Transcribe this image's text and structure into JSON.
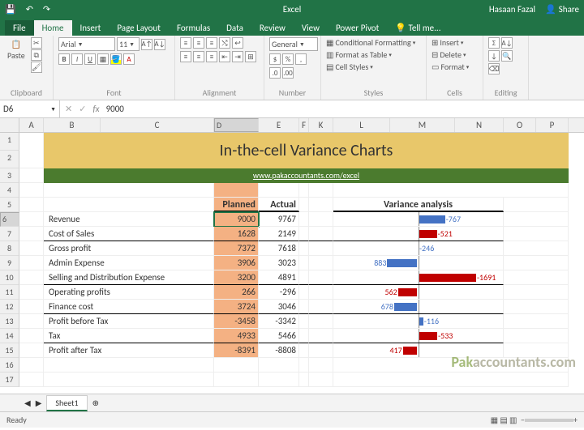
{
  "title_bar": {
    "title": "Excel",
    "user": "Hasaan Fazal",
    "share": "Share"
  },
  "tabs": {
    "file": "File",
    "items": [
      "Home",
      "Insert",
      "Page Layout",
      "Formulas",
      "Data",
      "Review",
      "View",
      "Power Pivot"
    ],
    "tell_me": "Tell me...",
    "active": "Home"
  },
  "ribbon": {
    "clipboard": {
      "label": "Clipboard",
      "paste": "Paste"
    },
    "font": {
      "label": "Font",
      "name": "Arial",
      "size": "11",
      "bold": "B",
      "italic": "I",
      "underline": "U"
    },
    "alignment": {
      "label": "Alignment"
    },
    "number": {
      "label": "Number",
      "format": "General"
    },
    "styles": {
      "label": "Styles",
      "cf": "Conditional Formatting",
      "tbl": "Format as Table",
      "cs": "Cell Styles"
    },
    "cells": {
      "label": "Cells",
      "insert": "Insert",
      "delete": "Delete",
      "format": "Format"
    },
    "editing": {
      "label": "Editing"
    }
  },
  "name_box": {
    "ref": "D6",
    "formula": "9000"
  },
  "columns": [
    "A",
    "B",
    "C",
    "D",
    "E",
    "F",
    "K",
    "L",
    "M",
    "N",
    "O",
    "P"
  ],
  "row_headers": [
    "1",
    "2",
    "3",
    "4",
    "5",
    "6",
    "7",
    "8",
    "9",
    "10",
    "11",
    "12",
    "13",
    "14",
    "15",
    "16",
    "17"
  ],
  "sheet": {
    "title": "In-the-cell Variance Charts",
    "link": "www.pakaccountants.com/excel",
    "hdr_planned": "Planned",
    "hdr_actual": "Actual",
    "hdr_variance": "Variance analysis",
    "rows": [
      {
        "label": "Revenue",
        "planned": "9000",
        "actual": "9767",
        "v": -767,
        "side": "right",
        "color": "blue"
      },
      {
        "label": "Cost of Sales",
        "planned": "1628",
        "actual": "2149",
        "v": -521,
        "side": "right",
        "color": "red",
        "uline": true
      },
      {
        "label": "Gross profit",
        "planned": "7372",
        "actual": "7618",
        "v": -246,
        "side": "right",
        "color": "blue",
        "nobar": true
      },
      {
        "label": "Admin Expense",
        "planned": "3906",
        "actual": "3023",
        "v": 883,
        "side": "left",
        "color": "blue"
      },
      {
        "label": "Selling and Distribution Expense",
        "planned": "3200",
        "actual": "4891",
        "v": -1691,
        "side": "right",
        "color": "red",
        "uline": true
      },
      {
        "label": "Operating profits",
        "planned": "266",
        "actual": "-296",
        "v": 562,
        "side": "left",
        "color": "red"
      },
      {
        "label": "Finance cost",
        "planned": "3724",
        "actual": "3046",
        "v": 678,
        "side": "left",
        "color": "blue",
        "uline": true
      },
      {
        "label": "Profit before Tax",
        "planned": "-3458",
        "actual": "-3342",
        "v": -116,
        "side": "right",
        "color": "blue"
      },
      {
        "label": "Tax",
        "planned": "4933",
        "actual": "5466",
        "v": -533,
        "side": "right",
        "color": "red",
        "uline": true
      },
      {
        "label": "Profit after Tax",
        "planned": "-8391",
        "actual": "-8808",
        "v": 417,
        "side": "left",
        "color": "red"
      }
    ]
  },
  "sheet_tabs": {
    "active": "Sheet1"
  },
  "status": {
    "ready": "Ready"
  },
  "chart_data": {
    "type": "bar",
    "title": "Variance analysis",
    "categories": [
      "Revenue",
      "Cost of Sales",
      "Gross profit",
      "Admin Expense",
      "Selling and Distribution Expense",
      "Operating profits",
      "Finance cost",
      "Profit before Tax",
      "Tax",
      "Profit after Tax"
    ],
    "series": [
      {
        "name": "Planned",
        "values": [
          9000,
          1628,
          7372,
          3906,
          3200,
          266,
          3724,
          -3458,
          4933,
          -8391
        ]
      },
      {
        "name": "Actual",
        "values": [
          9767,
          2149,
          7618,
          3023,
          4891,
          -296,
          3046,
          -3342,
          5466,
          -8808
        ]
      },
      {
        "name": "Variance",
        "values": [
          -767,
          -521,
          -246,
          883,
          -1691,
          562,
          678,
          -116,
          -533,
          417
        ]
      }
    ]
  }
}
